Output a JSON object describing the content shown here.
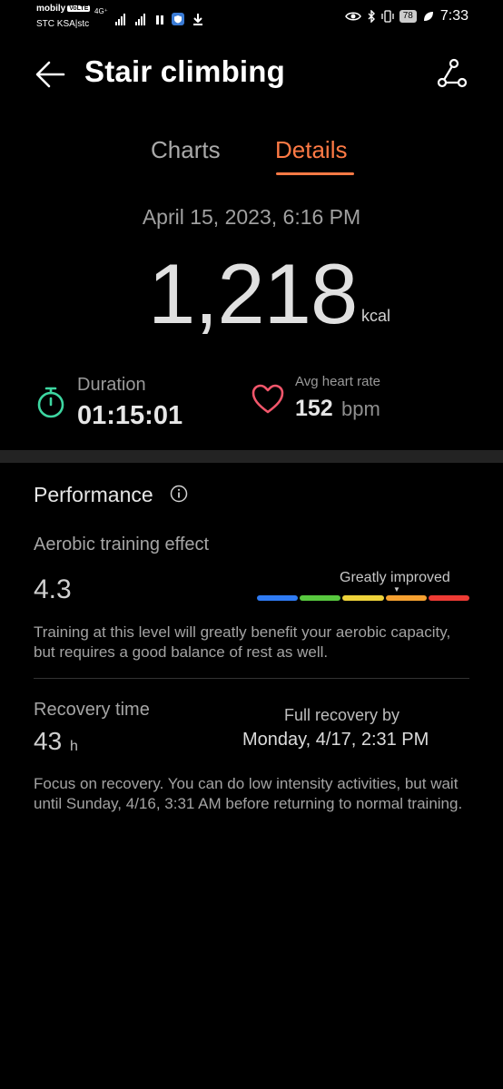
{
  "status_bar": {
    "carrier_primary": "mobily",
    "volte_badge": "VoLTE",
    "carrier_secondary": "STC KSA|stc",
    "network": "4G⁺",
    "battery": "78",
    "time": "7:33"
  },
  "header": {
    "title": "Stair climbing",
    "back_icon": "back-arrow-icon",
    "route_icon": "route-icon"
  },
  "tabs": [
    {
      "label": "Charts",
      "active": false
    },
    {
      "label": "Details",
      "active": true
    }
  ],
  "summary": {
    "date": "April 15, 2023, 6:16 PM",
    "calories": "1,218",
    "calories_unit": "kcal"
  },
  "stats": {
    "duration_label": "Duration",
    "duration_value": "01:15:01",
    "heart_rate_label": "Avg heart rate",
    "heart_rate_value": "152",
    "heart_rate_unit": "bpm"
  },
  "performance": {
    "title": "Performance",
    "aerobic_label": "Aerobic training effect",
    "aerobic_value": "4.3",
    "aerobic_level": "Greatly improved",
    "aerobic_description": "Training at this level will greatly benefit your aerobic capacity, but requires a good balance of rest as well.",
    "bar_colors": [
      "#2f7bf3",
      "#58c83f",
      "#eed23a",
      "#f5a030",
      "#ee3b34"
    ],
    "recovery_label": "Recovery time",
    "recovery_value": "43",
    "recovery_unit": "h",
    "full_recovery_label": "Full recovery by",
    "full_recovery_value": "Monday, 4/17, 2:31 PM",
    "recovery_description": "Focus on recovery. You can do low intensity activities, but wait until Sunday, 4/16, 3:31 AM before returning to normal training."
  },
  "colors": {
    "accent": "#ff7a45",
    "stopwatch": "#3dd6a1",
    "heart": "#f2566b"
  }
}
